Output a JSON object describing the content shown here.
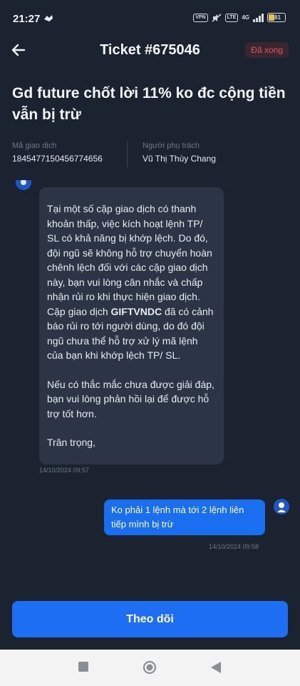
{
  "status_bar": {
    "time": "21:27",
    "vpn": "VPN",
    "network": "4G",
    "battery": "81"
  },
  "header": {
    "title": "Ticket #675046",
    "status_badge": "Đã xong"
  },
  "ticket": {
    "subject": "Gd future chốt lời 11% ko đc cộng tiền vẫn bị trừ",
    "transaction_label": "Mã giao dịch",
    "transaction_id": "1845477150456774656",
    "assignee_label": "Người phụ trách",
    "assignee": "Vũ Thị Thùy Chang"
  },
  "messages": {
    "support": {
      "p1": "Tại một số cặp giao dịch có thanh khoản thấp, việc kích hoạt lệnh TP/ SL có khả năng bị khớp lệch. Do đó, đội ngũ sẽ không hỗ trợ chuyển hoàn chênh lệch đối với các cặp giao dịch này, bạn vui lòng cân nhắc và chấp nhận rủi ro khi thực hiện giao dịch.",
      "p2_prefix": "Cặp giao dịch ",
      "p2_bold": "GIFTVNDC",
      "p2_suffix": " đã có cảnh báo rủi ro tới người dùng, do đó đội ngũ chưa thể hỗ trợ xử lý mã lệnh của bạn khi khớp lệch TP/ SL.",
      "p3": "Nếu có thắc mắc chưa được giải đáp, bạn vui lòng phản hồi lại để được hỗ trợ tốt hơn.",
      "p4": "Trân trọng,",
      "timestamp": "14/10/2024 09:57"
    },
    "user": {
      "text": "Ko phải 1 lệnh mà tới 2 lệnh liên tiếp mình bị trừ",
      "timestamp": "14/10/2024 09:58"
    }
  },
  "footer": {
    "follow_label": "Theo dõi"
  },
  "colors": {
    "background": "#1b2330",
    "accent": "#1d6ef2",
    "status_done": "#e0545e"
  }
}
